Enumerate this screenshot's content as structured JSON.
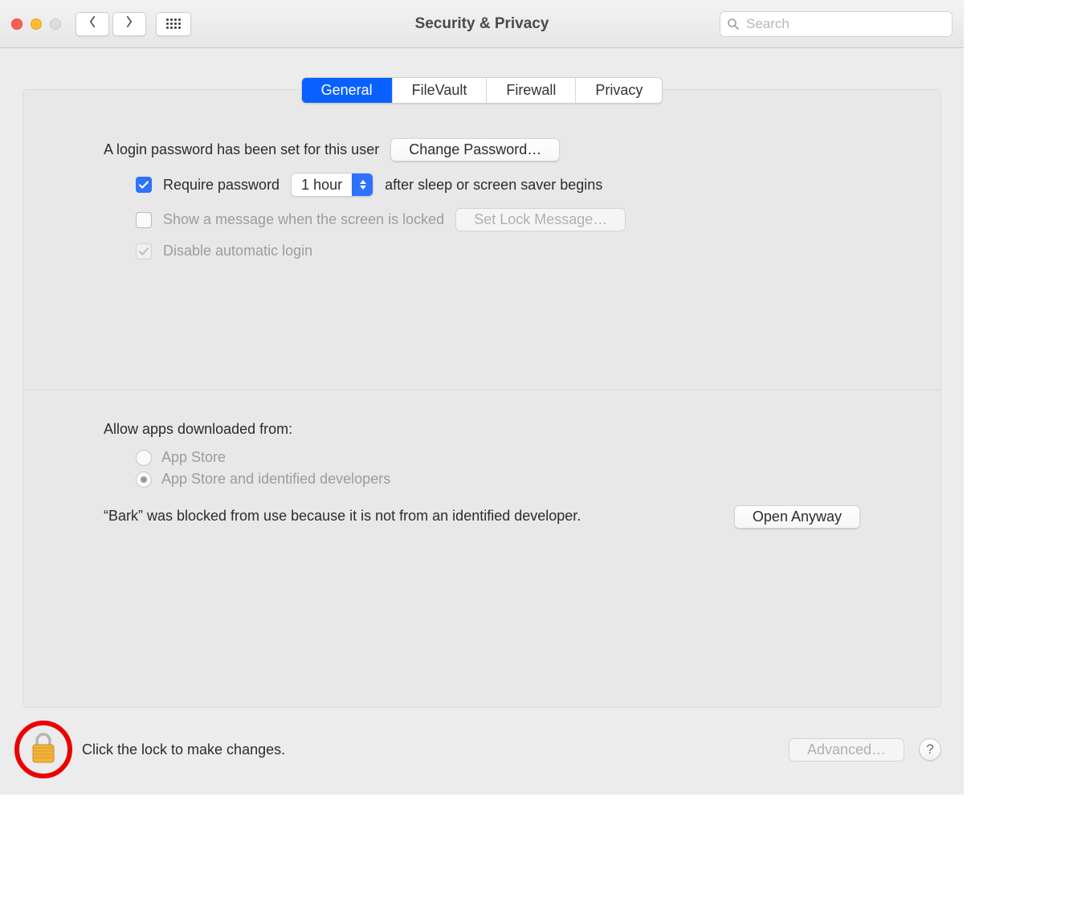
{
  "window": {
    "title": "Security & Privacy"
  },
  "toolbar": {
    "search_placeholder": "Search"
  },
  "tabs": {
    "items": [
      {
        "label": "General",
        "selected": true
      },
      {
        "label": "FileVault",
        "selected": false
      },
      {
        "label": "Firewall",
        "selected": false
      },
      {
        "label": "Privacy",
        "selected": false
      }
    ]
  },
  "general": {
    "login_password_set_text": "A login password has been set for this user",
    "change_password_button": "Change Password…",
    "require_password_label": "Require password",
    "require_password_checked": true,
    "delay_selected": "1 hour",
    "after_text": "after sleep or screen saver begins",
    "show_message_label": "Show a message when the screen is locked",
    "show_message_checked": false,
    "set_lock_message_button": "Set Lock Message…",
    "disable_auto_login_label": "Disable automatic login",
    "disable_auto_login_checked": true
  },
  "download": {
    "section_label": "Allow apps downloaded from:",
    "options": [
      {
        "label": "App Store",
        "selected": false
      },
      {
        "label": "App Store and identified developers",
        "selected": true
      }
    ],
    "blocked_message": "“Bark” was blocked from use because it is not from an identified developer.",
    "open_anyway_button": "Open Anyway"
  },
  "footer": {
    "lock_text": "Click the lock to make changes.",
    "advanced_button": "Advanced…",
    "help_label": "?"
  }
}
